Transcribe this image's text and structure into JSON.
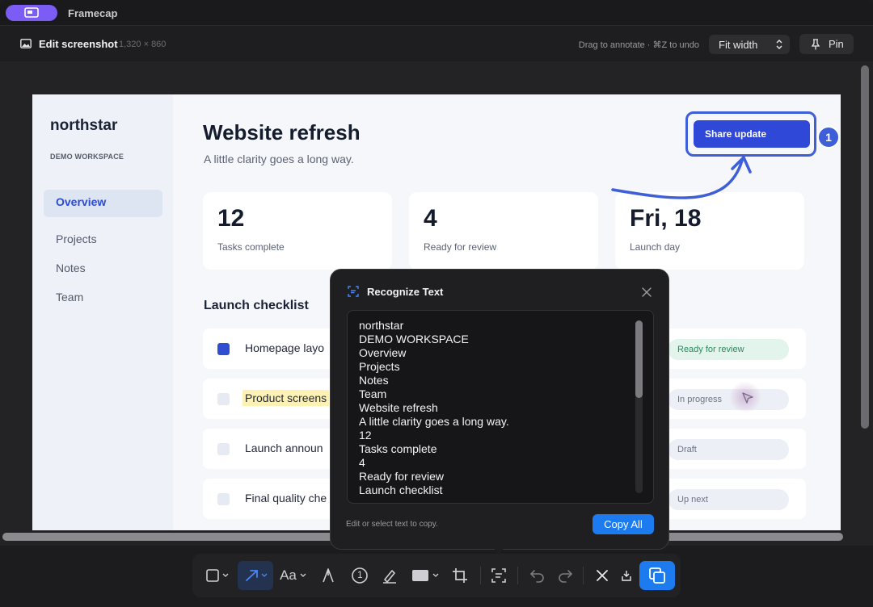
{
  "titlebar": {
    "app_name": "Framecap"
  },
  "header": {
    "title": "Edit screenshot",
    "dimensions": "1,320 × 860",
    "hint": "Drag to annotate · ⌘Z to undo",
    "zoom_select": "Fit width",
    "pin_label": "Pin"
  },
  "screenshot": {
    "brand": "northstar",
    "workspace": "DEMO WORKSPACE",
    "nav": [
      "Overview",
      "Projects",
      "Notes",
      "Team"
    ],
    "title": "Website refresh",
    "subtitle": "A little clarity goes a long way.",
    "share_button": "Share update",
    "step_number": "1",
    "stats": [
      {
        "value": "12",
        "label": "Tasks complete"
      },
      {
        "value": "4",
        "label": "Ready for review"
      },
      {
        "value": "Fri, 18",
        "label": "Launch day"
      }
    ],
    "section_title": "Launch checklist",
    "rows": [
      {
        "text": "Homepage layo",
        "status": "Ready for review"
      },
      {
        "text": "Product screens",
        "status": "In progress"
      },
      {
        "text": "Launch announ",
        "status": "Draft"
      },
      {
        "text": "Final quality che",
        "status": "Up next"
      }
    ]
  },
  "popup": {
    "title": "Recognize Text",
    "recognized_lines": [
      "northstar",
      "DEMO WORKSPACE",
      "Overview",
      "Projects",
      "Notes",
      "Team",
      "Website refresh",
      "A little clarity goes a long way.",
      "12",
      "Tasks complete",
      "4",
      "Ready for review",
      "Launch checklist"
    ],
    "hint": "Edit or select text to copy.",
    "copy_button": "Copy All"
  },
  "tools": {
    "text_tool_label": "Aa",
    "counter_label": "1"
  },
  "colors": {
    "accent": "#1d7bf0",
    "app_badge": "#7b5cf5",
    "annotation": "#3e5fd8",
    "highlight": "#fdf1b3"
  },
  "icons": {
    "app": "screen-icon",
    "edit": "image-icon",
    "rect_tool": "rectangle-icon",
    "arrow_tool": "arrow-icon",
    "pen_tool": "pen-nib-icon",
    "counter_tool": "counter-icon",
    "highlighter_tool": "highlighter-icon",
    "fill_tool": "fill-rect-icon",
    "crop_tool": "crop-icon",
    "ocr_tool": "text-scan-icon",
    "undo": "undo-icon",
    "redo": "redo-icon",
    "discard": "close-icon",
    "save": "save-icon",
    "copy": "copy-icon"
  }
}
